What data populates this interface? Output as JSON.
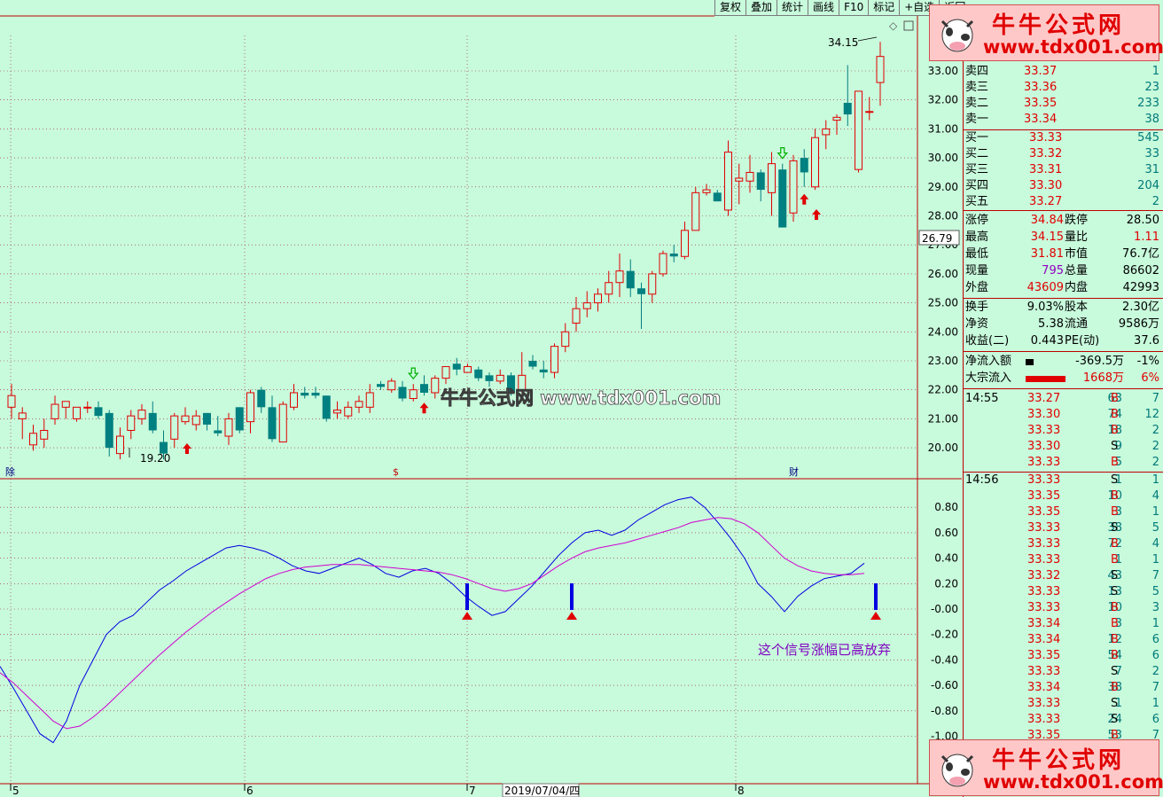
{
  "toolbar": {
    "items": [
      "复权",
      "叠加",
      "统计",
      "画线",
      "F10",
      "标记",
      "+自选",
      "返回"
    ]
  },
  "chart_data": [
    {
      "type": "candlestick",
      "y_ticks": [
        "33.00",
        "32.00",
        "31.00",
        "30.00",
        "29.00",
        "28.00",
        "27.00",
        "26.00",
        "25.00",
        "24.00",
        "23.00",
        "22.00",
        "21.00",
        "20.00"
      ],
      "ylim": [
        19.0,
        34.5
      ],
      "high_label": "34.15",
      "low_label": "19.20",
      "current_price_label": "26.79",
      "x_ticks": [
        {
          "label": "5",
          "pos": 0
        },
        {
          "label": "6",
          "pos": 0.259
        },
        {
          "label": "7",
          "pos": 0.509
        },
        {
          "label": "8",
          "pos": 0.798
        }
      ],
      "cursor_date": "2019/07/04/四",
      "candles": [
        [
          21.4,
          22.2,
          21.8,
          21.0
        ],
        [
          21.0,
          21.4,
          21.2,
          20.3
        ],
        [
          20.1,
          20.8,
          20.5,
          19.9
        ],
        [
          20.3,
          21.0,
          20.6,
          20.0
        ],
        [
          21.0,
          21.8,
          21.5,
          20.8
        ],
        [
          21.4,
          21.6,
          21.6,
          21.0
        ],
        [
          21.0,
          21.4,
          21.4,
          20.9
        ],
        [
          21.4,
          21.6,
          21.4,
          21.2
        ],
        [
          21.4,
          21.6,
          21.1,
          21.0
        ],
        [
          21.2,
          21.3,
          20.0,
          19.7
        ],
        [
          19.8,
          20.7,
          20.4,
          19.6
        ],
        [
          20.6,
          21.3,
          21.1,
          20.3
        ],
        [
          21.0,
          21.5,
          21.3,
          20.8
        ],
        [
          21.2,
          21.6,
          20.6,
          20.5
        ],
        [
          20.2,
          20.6,
          19.8,
          19.6
        ],
        [
          20.3,
          21.2,
          21.1,
          20.0
        ],
        [
          20.9,
          21.4,
          21.1,
          20.8
        ],
        [
          20.8,
          21.3,
          21.1,
          20.6
        ],
        [
          21.2,
          21.2,
          20.8,
          20.6
        ],
        [
          20.6,
          21.1,
          20.5,
          20.4
        ],
        [
          20.4,
          21.2,
          21.0,
          20.1
        ],
        [
          21.4,
          21.4,
          20.6,
          20.5
        ],
        [
          20.9,
          22.0,
          21.9,
          20.5
        ],
        [
          22.0,
          22.1,
          21.4,
          21.2
        ],
        [
          21.4,
          21.8,
          20.3,
          20.2
        ],
        [
          20.2,
          21.6,
          21.5,
          20.2
        ],
        [
          21.4,
          22.2,
          21.9,
          21.3
        ],
        [
          21.9,
          22.1,
          21.8,
          21.7
        ],
        [
          21.9,
          22.1,
          21.8,
          21.7
        ],
        [
          21.8,
          21.8,
          21.0,
          20.9
        ],
        [
          21.2,
          21.6,
          21.3,
          21.0
        ],
        [
          21.1,
          21.6,
          21.4,
          21.0
        ],
        [
          21.4,
          21.8,
          21.6,
          21.2
        ],
        [
          21.4,
          22.2,
          21.9,
          21.2
        ],
        [
          22.2,
          22.3,
          22.1,
          22.0
        ],
        [
          22.0,
          22.4,
          22.3,
          21.9
        ],
        [
          22.1,
          22.3,
          21.7,
          21.6
        ],
        [
          21.7,
          22.2,
          22.0,
          21.6
        ],
        [
          22.2,
          22.5,
          21.9,
          21.8
        ],
        [
          21.9,
          22.5,
          22.4,
          21.7
        ],
        [
          22.4,
          22.8,
          22.8,
          22.2
        ],
        [
          22.9,
          23.1,
          22.7,
          22.5
        ],
        [
          22.6,
          22.9,
          22.8,
          22.6
        ],
        [
          22.7,
          22.8,
          22.4,
          22.3
        ],
        [
          22.5,
          22.6,
          22.3,
          22.1
        ],
        [
          22.3,
          22.7,
          22.5,
          22.2
        ],
        [
          22.5,
          22.6,
          21.9,
          21.8
        ],
        [
          22.0,
          23.3,
          22.5,
          21.9
        ],
        [
          23.0,
          23.2,
          22.8,
          22.7
        ],
        [
          22.7,
          23.0,
          22.6,
          22.4
        ],
        [
          22.6,
          23.6,
          23.5,
          22.4
        ],
        [
          23.5,
          24.3,
          24.0,
          23.3
        ],
        [
          24.3,
          25.2,
          24.8,
          24.0
        ],
        [
          24.8,
          25.4,
          25.0,
          24.5
        ],
        [
          25.0,
          25.5,
          25.3,
          24.7
        ],
        [
          25.3,
          26.1,
          25.7,
          25.0
        ],
        [
          25.7,
          26.7,
          26.1,
          25.2
        ],
        [
          26.1,
          26.5,
          25.5,
          25.2
        ],
        [
          25.5,
          25.7,
          25.3,
          24.1
        ],
        [
          25.3,
          26.1,
          26.0,
          25.0
        ],
        [
          26.0,
          26.8,
          26.7,
          25.9
        ],
        [
          26.7,
          27.0,
          26.6,
          26.4
        ],
        [
          26.6,
          27.8,
          27.5,
          26.5
        ],
        [
          27.5,
          29.0,
          28.8,
          27.5
        ],
        [
          28.8,
          29.1,
          28.9,
          28.7
        ],
        [
          28.8,
          28.9,
          28.5,
          28.5
        ],
        [
          28.2,
          30.6,
          30.2,
          28.0
        ],
        [
          29.2,
          29.8,
          29.3,
          28.4
        ],
        [
          29.2,
          30.1,
          29.5,
          28.8
        ],
        [
          29.5,
          29.6,
          28.9,
          28.5
        ],
        [
          28.8,
          30.2,
          29.8,
          28.0
        ],
        [
          29.6,
          29.8,
          27.6,
          27.6
        ],
        [
          28.1,
          30.1,
          29.9,
          27.8
        ],
        [
          30.0,
          30.3,
          29.5,
          29.0
        ],
        [
          29.0,
          31.0,
          30.7,
          28.9
        ],
        [
          30.8,
          31.3,
          31.0,
          30.3
        ],
        [
          31.3,
          31.5,
          31.4,
          30.8
        ],
        [
          31.9,
          33.2,
          31.5,
          31.1
        ],
        [
          29.6,
          32.1,
          32.3,
          29.5
        ],
        [
          31.6,
          32.1,
          31.6,
          31.3
        ],
        [
          32.6,
          34.0,
          33.5,
          31.8
        ]
      ],
      "signals": [
        {
          "type": "sell-arrow",
          "index": 37
        },
        {
          "type": "buy-arrow",
          "index": 38
        },
        {
          "type": "sell-arrow",
          "index": 71
        },
        {
          "type": "buy-arrow",
          "index": 73
        }
      ],
      "bottom_markers": [
        "除",
        "$",
        "财"
      ]
    },
    {
      "type": "line",
      "y_ticks": [
        "0.80",
        "0.60",
        "0.40",
        "0.20",
        "-0.00",
        "-0.20",
        "-0.40",
        "-0.60",
        "-0.80",
        "-1.00"
      ],
      "ylim": [
        -1.08,
        0.95
      ],
      "series": [
        {
          "color": "#0000e0",
          "values": [
            -0.45,
            -0.62,
            -0.8,
            -0.98,
            -1.05,
            -0.88,
            -0.6,
            -0.4,
            -0.2,
            -0.1,
            -0.05,
            0.05,
            0.15,
            0.22,
            0.3,
            0.36,
            0.42,
            0.48,
            0.5,
            0.48,
            0.45,
            0.4,
            0.34,
            0.3,
            0.28,
            0.32,
            0.36,
            0.4,
            0.35,
            0.28,
            0.25,
            0.3,
            0.32,
            0.28,
            0.2,
            0.1,
            0.02,
            -0.05,
            -0.02,
            0.08,
            0.18,
            0.3,
            0.42,
            0.52,
            0.6,
            0.62,
            0.58,
            0.62,
            0.7,
            0.76,
            0.82,
            0.86,
            0.88,
            0.8,
            0.68,
            0.55,
            0.4,
            0.2,
            0.1,
            -0.02,
            0.1,
            0.18,
            0.24,
            0.26,
            0.28,
            0.36
          ]
        },
        {
          "color": "#d000d0",
          "values": [
            -0.5,
            -0.58,
            -0.68,
            -0.78,
            -0.88,
            -0.94,
            -0.92,
            -0.85,
            -0.76,
            -0.66,
            -0.56,
            -0.46,
            -0.36,
            -0.27,
            -0.18,
            -0.1,
            -0.02,
            0.05,
            0.12,
            0.18,
            0.24,
            0.28,
            0.31,
            0.33,
            0.34,
            0.35,
            0.35,
            0.35,
            0.34,
            0.33,
            0.32,
            0.31,
            0.3,
            0.29,
            0.27,
            0.24,
            0.2,
            0.16,
            0.14,
            0.16,
            0.2,
            0.27,
            0.34,
            0.4,
            0.45,
            0.48,
            0.5,
            0.52,
            0.55,
            0.58,
            0.61,
            0.64,
            0.68,
            0.7,
            0.72,
            0.71,
            0.67,
            0.6,
            0.5,
            0.4,
            0.34,
            0.3,
            0.28,
            0.27,
            0.27,
            0.28
          ]
        }
      ],
      "signal_bars": [
        39,
        48,
        91
      ],
      "annotation": "这个信号涨幅已高放弃"
    }
  ],
  "quote": {
    "ask": [
      {
        "label": "卖四",
        "price": "33.37",
        "vol": "1"
      },
      {
        "label": "卖三",
        "price": "33.36",
        "vol": "23"
      },
      {
        "label": "卖二",
        "price": "33.35",
        "vol": "233"
      },
      {
        "label": "卖一",
        "price": "33.34",
        "vol": "38"
      }
    ],
    "bid": [
      {
        "label": "买一",
        "price": "33.33",
        "vol": "545"
      },
      {
        "label": "买二",
        "price": "33.32",
        "vol": "33"
      },
      {
        "label": "买三",
        "price": "33.31",
        "vol": "31"
      },
      {
        "label": "买四",
        "price": "33.30",
        "vol": "204"
      },
      {
        "label": "买五",
        "price": "33.27",
        "vol": "2"
      }
    ],
    "stats": [
      {
        "l1": "涨停",
        "v1": "34.84",
        "l2": "跌停",
        "v2": "28.50"
      },
      {
        "l1": "最高",
        "v1": "34.15",
        "l2": "量比",
        "v2": "1.11"
      },
      {
        "l1": "最低",
        "v1": "31.81",
        "l2": "市值",
        "v2": "76.7亿"
      },
      {
        "l1": "现量",
        "v1": "795",
        "l2": "总量",
        "v2": "86602"
      },
      {
        "l1": "外盘",
        "v1": "43609",
        "l2": "内盘",
        "v2": "42993"
      },
      {
        "l1": "换手",
        "v1": "9.03%",
        "l2": "股本",
        "v2": "2.30亿"
      },
      {
        "l1": "净资",
        "v1": "5.38",
        "l2": "流通",
        "v2": "9586万"
      },
      {
        "l1": "收益(二)",
        "v1": "0.443",
        "l2": "PE(动)",
        "v2": "37.6"
      }
    ],
    "flow": [
      {
        "label": "净流入额",
        "value": "-369.5万",
        "pct": "-1%"
      },
      {
        "label": "大宗流入",
        "value": "1668万",
        "pct": "6%"
      }
    ]
  },
  "ticks": {
    "t1455": "14:55",
    "t1456": "14:56",
    "rows1": [
      [
        "33.27",
        "63",
        "B",
        "7"
      ],
      [
        "33.30",
        "74",
        "B",
        "12"
      ],
      [
        "33.33",
        "18",
        "B",
        "2"
      ],
      [
        "33.30",
        "9",
        "S",
        "2"
      ],
      [
        "33.33",
        "5",
        "B",
        "2"
      ]
    ],
    "rows2": [
      [
        "33.33",
        "1",
        "S",
        "1"
      ],
      [
        "33.35",
        "10",
        "B",
        "4"
      ],
      [
        "33.35",
        "3",
        "B",
        "1"
      ],
      [
        "33.33",
        "38",
        "S",
        "5"
      ],
      [
        "33.33",
        "72",
        "B",
        "4"
      ],
      [
        "33.33",
        "1",
        "B",
        "1"
      ],
      [
        "33.32",
        "43",
        "S",
        "7"
      ],
      [
        "33.33",
        "13",
        "S",
        "5"
      ],
      [
        "33.33",
        "10",
        "B",
        "3"
      ],
      [
        "33.34",
        "3",
        "B",
        "1"
      ],
      [
        "33.34",
        "12",
        "B",
        "6"
      ],
      [
        "33.35",
        "54",
        "B",
        "6"
      ],
      [
        "33.33",
        "7",
        "S",
        "2"
      ],
      [
        "33.34",
        "38",
        "B",
        "7"
      ],
      [
        "33.33",
        "1",
        "S",
        "1"
      ],
      [
        "33.33",
        "24",
        "S",
        "6"
      ],
      [
        "33.35",
        "53",
        "B",
        "7"
      ]
    ]
  },
  "watermark": {
    "title": "牛牛公式网",
    "url": "www.tdx001.com",
    "center_text": "牛牛公式网 www.tdx001.com"
  }
}
